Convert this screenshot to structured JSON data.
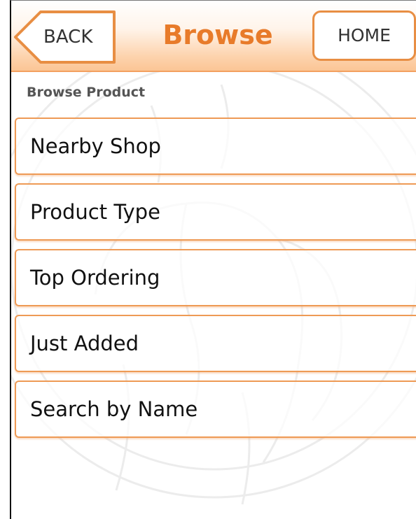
{
  "header": {
    "back_label": "BACK",
    "title": "Browse",
    "home_label": "HOME"
  },
  "section": {
    "label": "Browse Product"
  },
  "menu": {
    "items": [
      {
        "label": "Nearby Shop"
      },
      {
        "label": "Product Type"
      },
      {
        "label": "Top Ordering"
      },
      {
        "label": "Just Added"
      },
      {
        "label": "Search by Name"
      }
    ]
  },
  "colors": {
    "accent": "#e87b2a",
    "border": "#ee9a55",
    "header_bottom": "#fbc595"
  },
  "icons": {
    "back": "back-arrow-icon",
    "watermark": "elephant-seal-watermark"
  }
}
